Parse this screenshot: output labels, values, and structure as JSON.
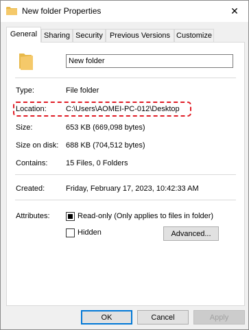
{
  "window": {
    "title": "New folder Properties",
    "close_glyph": "✕",
    "icon": "folder-icon"
  },
  "tabs": [
    {
      "label": "General",
      "active": true
    },
    {
      "label": "Sharing",
      "active": false
    },
    {
      "label": "Security",
      "active": false
    },
    {
      "label": "Previous Versions",
      "active": false
    },
    {
      "label": "Customize",
      "active": false
    }
  ],
  "general": {
    "folder_name": "New folder",
    "type_label": "Type:",
    "type_value": "File folder",
    "location_label": "Location:",
    "location_value": "C:\\Users\\AOMEI-PC-012\\Desktop",
    "size_label": "Size:",
    "size_value": "653 KB (669,098 bytes)",
    "size_on_disk_label": "Size on disk:",
    "size_on_disk_value": "688 KB (704,512 bytes)",
    "contains_label": "Contains:",
    "contains_value": "15 Files, 0 Folders",
    "created_label": "Created:",
    "created_value": "Friday, February 17, 2023, 10:42:33 AM",
    "attributes_label": "Attributes:",
    "readonly_label": "Read-only (Only applies to files in folder)",
    "readonly_state": "indeterminate",
    "hidden_label": "Hidden",
    "hidden_checked": false,
    "advanced_label": "Advanced..."
  },
  "buttons": {
    "ok": "OK",
    "cancel": "Cancel",
    "apply": "Apply",
    "apply_enabled": false
  },
  "colors": {
    "highlight": "#e01b24",
    "folder": "#f5c96a",
    "accent": "#0078d7"
  }
}
